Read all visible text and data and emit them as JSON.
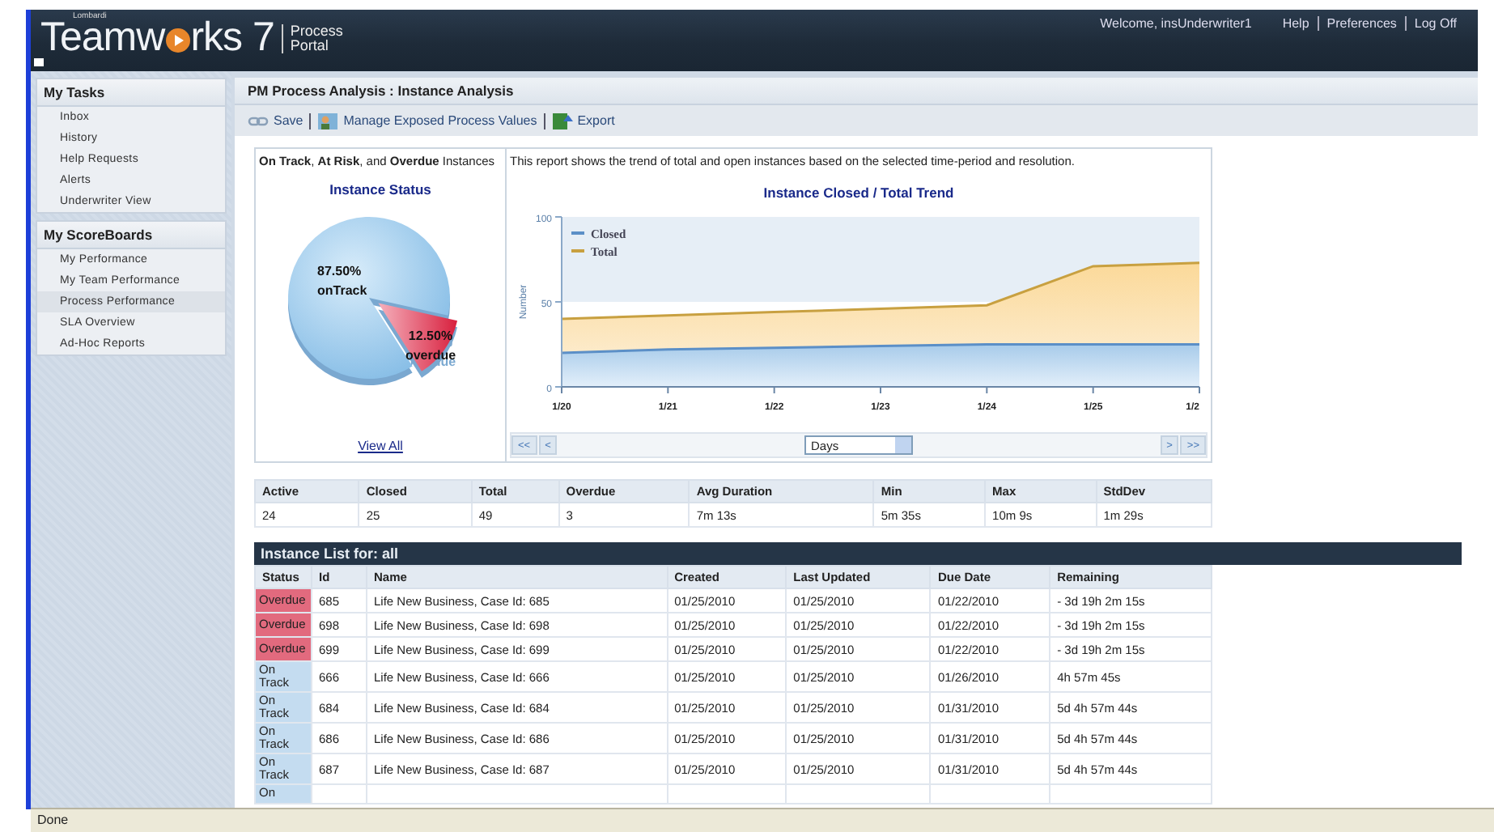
{
  "header": {
    "logo_small": "Lombardi",
    "logo_parts": [
      "Teamw",
      "rks 7"
    ],
    "logo_sub": [
      "Process",
      "Portal"
    ],
    "welcome": "Welcome, insUnderwriter1",
    "links": [
      "Help",
      "Preferences",
      "Log Off"
    ]
  },
  "sidebar": {
    "sections": [
      {
        "title": "My Tasks",
        "items": [
          {
            "label": "Inbox",
            "selected": false
          },
          {
            "label": "History",
            "selected": false
          },
          {
            "label": "Help Requests",
            "selected": false
          },
          {
            "label": "Alerts",
            "selected": false
          },
          {
            "label": "Underwriter View",
            "selected": false
          }
        ]
      },
      {
        "title": "My ScoreBoards",
        "items": [
          {
            "label": "My Performance",
            "selected": false
          },
          {
            "label": "My Team Performance",
            "selected": false
          },
          {
            "label": "Process Performance",
            "selected": true
          },
          {
            "label": "SLA Overview",
            "selected": false
          },
          {
            "label": "Ad-Hoc Reports",
            "selected": false
          }
        ]
      }
    ]
  },
  "page": {
    "title": "PM Process Analysis : Instance Analysis",
    "toolbar": [
      {
        "kind": "save",
        "label": "Save"
      },
      {
        "kind": "manage",
        "label": "Manage Exposed Process Values"
      },
      {
        "kind": "export",
        "label": "Export"
      }
    ]
  },
  "status_panel": {
    "heading": "**On Track**, **At Risk**, and **Overdue** Instances",
    "link": "View All",
    "chart_data": {
      "type": "pie",
      "title": "Instance Status",
      "categories": [
        "onTrack",
        "overdue"
      ],
      "values": [
        87.5,
        12.5
      ],
      "value_labels": [
        "87.50%",
        "12.50%"
      ]
    }
  },
  "trend_panel": {
    "description": "This report shows the trend of total and open instances based on the selected time-period and resolution.",
    "resolution": "Days",
    "nav_back": [
      "<<",
      "<"
    ],
    "nav_forward": [
      ">",
      ">>"
    ],
    "chart_data": {
      "type": "area",
      "title": "Instance Closed / Total Trend",
      "ylabel": "Number",
      "legend": "upper left",
      "categories": [
        "1/20",
        "1/21",
        "1/22",
        "1/23",
        "1/24",
        "1/25",
        "1/2"
      ],
      "ylim": [
        0,
        100
      ],
      "yticks": [
        0,
        50,
        100
      ],
      "series": [
        {
          "name": "Closed",
          "color": "#5b8fc7",
          "values": [
            20,
            22,
            23,
            24,
            25,
            25,
            25
          ]
        },
        {
          "name": "Total",
          "color": "#c8a040",
          "values": [
            40,
            42,
            44,
            46,
            48,
            71,
            73
          ]
        }
      ]
    }
  },
  "stats": {
    "columns": [
      "Active",
      "Closed",
      "Total",
      "Overdue",
      "Avg Duration",
      "Min",
      "Max",
      "StdDev"
    ],
    "values": [
      "24",
      "25",
      "49",
      "3",
      "7m 13s",
      "5m 35s",
      "10m 9s",
      "1m 29s"
    ]
  },
  "instance_list": {
    "title": "Instance List for: all",
    "columns": [
      "Status",
      "Id",
      "Name",
      "Created",
      "Last Updated",
      "Due Date",
      "Remaining"
    ],
    "rows": [
      {
        "kind": "overdue",
        "cells": [
          "Overdue",
          "685",
          "Life New Business, Case Id: 685",
          "01/25/2010",
          "01/25/2010",
          "01/22/2010",
          "- 3d 19h 2m 15s"
        ]
      },
      {
        "kind": "overdue",
        "cells": [
          "Overdue",
          "698",
          "Life New Business, Case Id: 698",
          "01/25/2010",
          "01/25/2010",
          "01/22/2010",
          "- 3d 19h 2m 15s"
        ]
      },
      {
        "kind": "overdue",
        "cells": [
          "Overdue",
          "699",
          "Life New Business, Case Id: 699",
          "01/25/2010",
          "01/25/2010",
          "01/22/2010",
          "- 3d 19h 2m 15s"
        ]
      },
      {
        "kind": "on_track",
        "cells": [
          "On Track",
          "666",
          "Life New Business, Case Id: 666",
          "01/25/2010",
          "01/25/2010",
          "01/26/2010",
          "4h 57m 45s"
        ]
      },
      {
        "kind": "on_track",
        "cells": [
          "On Track",
          "684",
          "Life New Business, Case Id: 684",
          "01/25/2010",
          "01/25/2010",
          "01/31/2010",
          "5d 4h 57m 44s"
        ]
      },
      {
        "kind": "on_track",
        "cells": [
          "On Track",
          "686",
          "Life New Business, Case Id: 686",
          "01/25/2010",
          "01/25/2010",
          "01/31/2010",
          "5d 4h 57m 44s"
        ]
      },
      {
        "kind": "on_track",
        "cells": [
          "On Track",
          "687",
          "Life New Business, Case Id: 687",
          "01/25/2010",
          "01/25/2010",
          "01/31/2010",
          "5d 4h 57m 44s"
        ]
      },
      {
        "kind": "on_track",
        "cells": [
          "On"
        ]
      }
    ]
  },
  "status_bar": "Done"
}
